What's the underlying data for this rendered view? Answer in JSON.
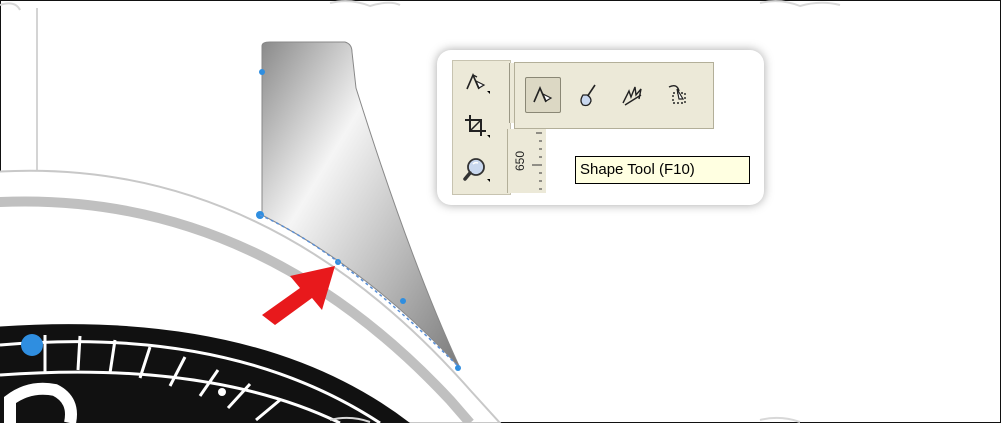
{
  "toolbox": {
    "tools": [
      {
        "icon": "shape-tool-icon"
      },
      {
        "icon": "crop-tool-icon"
      },
      {
        "icon": "zoom-tool-icon"
      }
    ],
    "flyout": [
      {
        "icon": "shape-tool-icon",
        "active": true
      },
      {
        "icon": "smudge-brush-icon",
        "active": false
      },
      {
        "icon": "roughen-brush-icon",
        "active": false
      },
      {
        "icon": "transform-tool-icon",
        "active": false
      }
    ]
  },
  "ruler": {
    "label": "650"
  },
  "tooltip": {
    "text": "Shape Tool (F10)"
  },
  "colors": {
    "arrow": "#e8191c",
    "node": "#2f8ee0",
    "panel": "#ece9d8",
    "tooltip_bg": "#ffffe1"
  }
}
